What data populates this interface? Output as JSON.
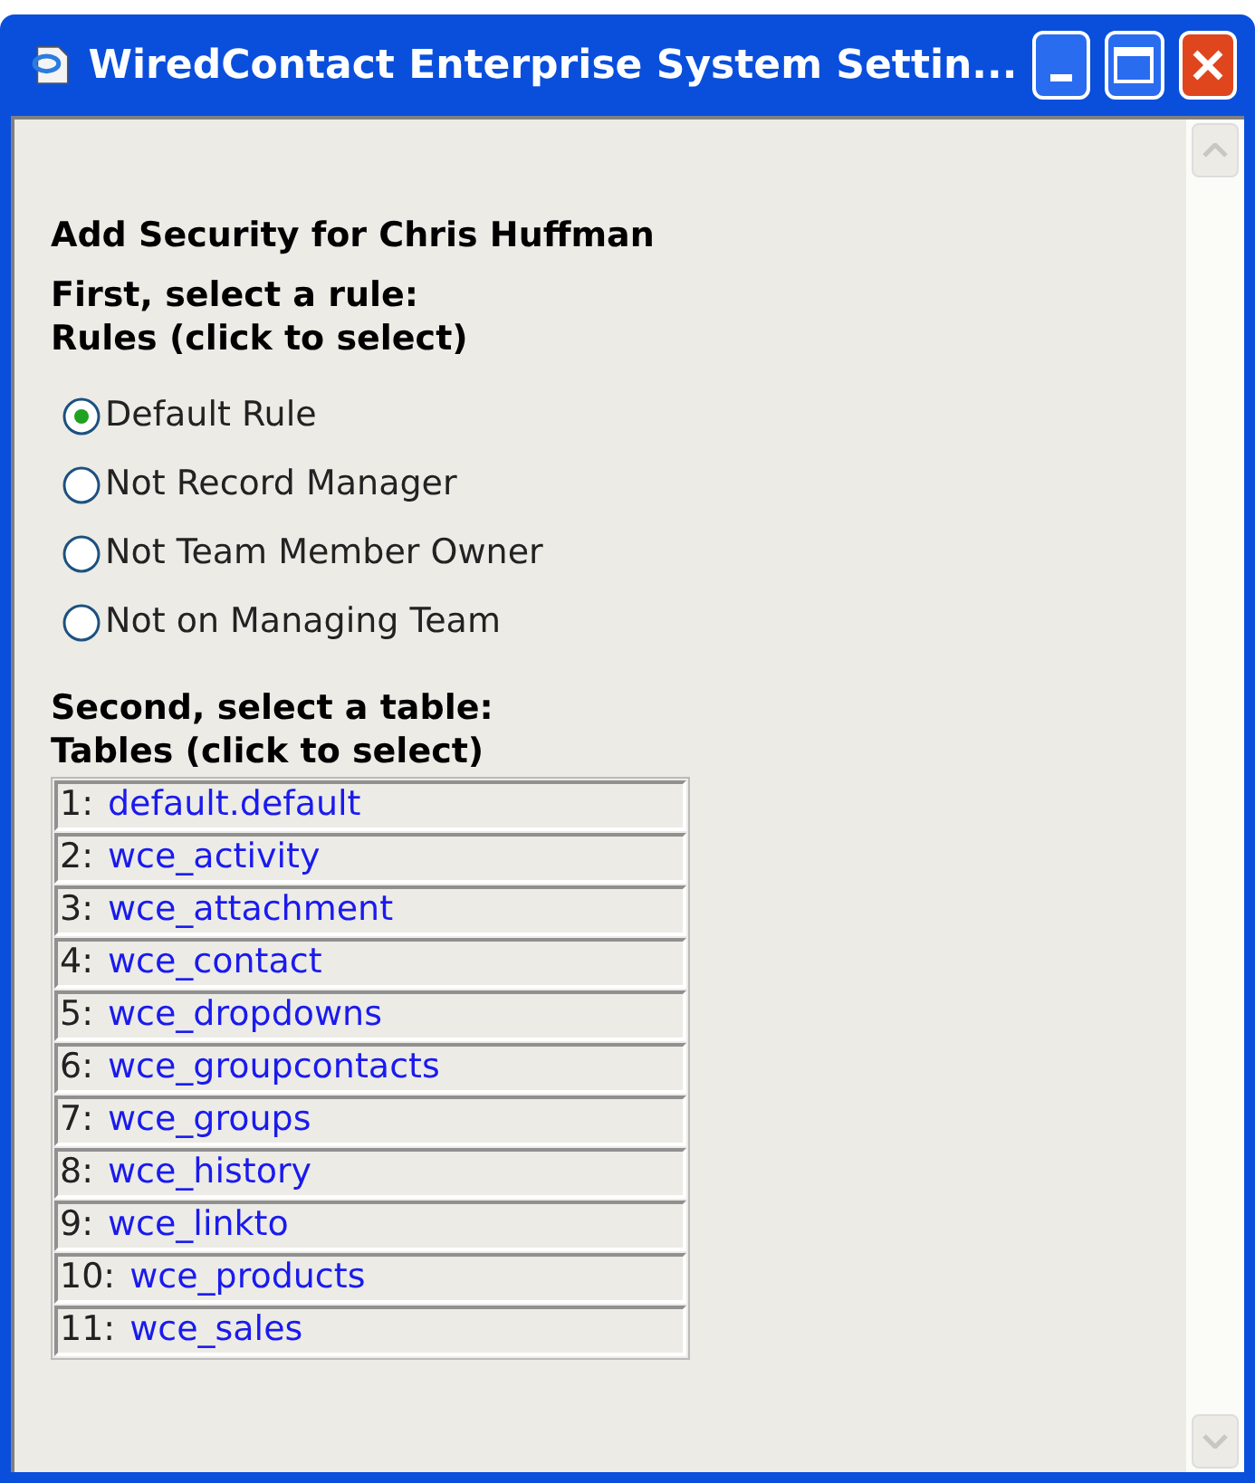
{
  "window": {
    "title": "WiredContact Enterprise System Settin..."
  },
  "heading": "Add Security for Chris Huffman",
  "rules_section": {
    "title": "First, select a rule:",
    "subtitle": "Rules (click to select)"
  },
  "rules": [
    {
      "label": "Default Rule",
      "selected": true
    },
    {
      "label": "Not Record Manager",
      "selected": false
    },
    {
      "label": "Not Team Member Owner",
      "selected": false
    },
    {
      "label": "Not on Managing Team",
      "selected": false
    }
  ],
  "tables_section": {
    "title": "Second, select a table:",
    "subtitle": "Tables (click to select)"
  },
  "tables": [
    {
      "number": "1:",
      "name": "default.default"
    },
    {
      "number": "2:",
      "name": "wce_activity"
    },
    {
      "number": "3:",
      "name": "wce_attachment"
    },
    {
      "number": "4:",
      "name": "wce_contact"
    },
    {
      "number": "5:",
      "name": "wce_dropdowns"
    },
    {
      "number": "6:",
      "name": "wce_groupcontacts"
    },
    {
      "number": "7:",
      "name": "wce_groups"
    },
    {
      "number": "8:",
      "name": "wce_history"
    },
    {
      "number": "9:",
      "name": "wce_linkto"
    },
    {
      "number": "10:",
      "name": "wce_products"
    },
    {
      "number": "11:",
      "name": "wce_sales"
    }
  ]
}
